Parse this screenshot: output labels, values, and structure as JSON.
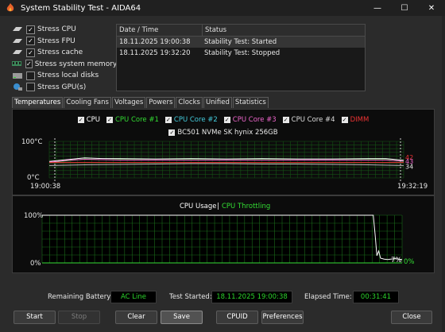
{
  "window": {
    "title": "System Stability Test - AIDA64",
    "min_glyph": "—",
    "max_glyph": "☐",
    "close_glyph": "✕"
  },
  "stress_options": [
    {
      "label": "Stress CPU",
      "checked": true,
      "icon": "cpu-icon"
    },
    {
      "label": "Stress FPU",
      "checked": true,
      "icon": "fpu-icon"
    },
    {
      "label": "Stress cache",
      "checked": true,
      "icon": "cache-icon"
    },
    {
      "label": "Stress system memory",
      "checked": true,
      "icon": "memory-icon"
    },
    {
      "label": "Stress local disks",
      "checked": false,
      "icon": "disk-icon"
    },
    {
      "label": "Stress GPU(s)",
      "checked": false,
      "icon": "gpu-icon"
    }
  ],
  "log": {
    "columns": [
      "Date / Time",
      "Status"
    ],
    "rows": [
      {
        "datetime": "18.11.2025 19:00:38",
        "status": "Stability Test: Started"
      },
      {
        "datetime": "18.11.2025 19:32:20",
        "status": "Stability Test: Stopped"
      }
    ]
  },
  "tabs": [
    {
      "label": "Temperatures",
      "active": true
    },
    {
      "label": "Cooling Fans",
      "active": false
    },
    {
      "label": "Voltages",
      "active": false
    },
    {
      "label": "Powers",
      "active": false
    },
    {
      "label": "Clocks",
      "active": false
    },
    {
      "label": "Unified",
      "active": false
    },
    {
      "label": "Statistics",
      "active": false
    }
  ],
  "temp_legend_row1": [
    {
      "label": "CPU",
      "color": "#ffffff",
      "checked": true
    },
    {
      "label": "CPU Core #1",
      "color": "#33dd33",
      "checked": true
    },
    {
      "label": "CPU Core #2",
      "color": "#44ccdd",
      "checked": true
    },
    {
      "label": "CPU Core #3",
      "color": "#ee66cc",
      "checked": true
    },
    {
      "label": "CPU Core #4",
      "color": "#dddddd",
      "checked": true
    },
    {
      "label": "DIMM",
      "color": "#ee3333",
      "checked": true
    }
  ],
  "temp_legend_row2": [
    {
      "label": "BC501 NVMe SK hynix 256GB",
      "color": "#e8e8e8",
      "checked": true
    }
  ],
  "chart_data": [
    {
      "type": "line",
      "title": "",
      "x_labels": [
        "19:00:38",
        "19:32:19"
      ],
      "ylim": [
        0,
        100
      ],
      "y_labels": [
        "100°C",
        "0°C"
      ],
      "grid": true,
      "series": [
        {
          "name": "CPU",
          "color": "#ffffff",
          "x": [
            0,
            0.05,
            0.1,
            0.15,
            0.2,
            0.3,
            0.4,
            0.5,
            0.6,
            0.7,
            0.8,
            0.9,
            0.95,
            1.0
          ],
          "values": [
            45,
            50,
            55,
            53,
            53,
            52,
            53,
            52,
            53,
            52,
            52,
            53,
            53,
            48
          ]
        },
        {
          "name": "CPU Core #1",
          "color": "#33dd33",
          "x": [
            0,
            0.05,
            0.1,
            0.15,
            0.2,
            0.3,
            0.4,
            0.5,
            0.6,
            0.7,
            0.8,
            0.9,
            0.95,
            1.0
          ],
          "values": [
            42,
            47,
            52,
            50,
            50,
            49,
            50,
            49,
            50,
            49,
            49,
            50,
            50,
            45
          ]
        },
        {
          "name": "CPU Core #3",
          "color": "#ee66cc",
          "x": [
            0,
            0.05,
            0.1,
            0.15,
            0.2,
            0.3,
            0.4,
            0.5,
            0.6,
            0.7,
            0.8,
            0.9,
            0.95,
            1.0
          ],
          "values": [
            43,
            48,
            51,
            50,
            49,
            49,
            49,
            49,
            49,
            49,
            49,
            49,
            49,
            46
          ]
        },
        {
          "name": "DIMM",
          "color": "#ee3333",
          "x": [
            0,
            0.5,
            1.0
          ],
          "values": [
            42,
            42,
            42
          ]
        },
        {
          "name": "BC501 NVMe SK hynix 256GB",
          "color": "#bbbbbb",
          "x": [
            0,
            0.1,
            0.2,
            0.3,
            0.4,
            0.5,
            0.6,
            0.7,
            0.8,
            0.9,
            1.0
          ],
          "values": [
            34,
            36,
            37,
            38,
            39,
            39,
            38,
            38,
            37,
            36,
            34
          ]
        }
      ],
      "end_labels": [
        {
          "text": "42",
          "color": "#ee3333"
        },
        {
          "text": "43",
          "color": "#ee66cc"
        },
        {
          "text": "34",
          "color": "#e8e8e8"
        }
      ]
    },
    {
      "type": "line",
      "title": "CPU Usage",
      "title2": "CPU Throttling",
      "title_sep": "|",
      "ylim": [
        0,
        100
      ],
      "y_labels": [
        "100%",
        "0%"
      ],
      "grid": true,
      "series": [
        {
          "name": "CPU Usage",
          "color": "#ffffff",
          "x": [
            0,
            0.5,
            0.92,
            0.925,
            0.93,
            0.935,
            0.94,
            0.95,
            0.96,
            0.98,
            1.0
          ],
          "values": [
            100,
            100,
            100,
            60,
            15,
            25,
            10,
            8,
            7,
            9,
            7
          ]
        },
        {
          "name": "CPU Throttling",
          "color": "#33dd33",
          "x": [
            0,
            1.0
          ],
          "values": [
            0,
            0
          ]
        }
      ],
      "end_labels": [
        {
          "text": "7%",
          "color": "#ffffff"
        },
        {
          "text": "0%",
          "color": "#33dd33"
        }
      ]
    }
  ],
  "status": {
    "battery_label": "Remaining Battery:",
    "battery_value": "AC Line",
    "started_label": "Test Started:",
    "started_value": "18.11.2025 19:00:38",
    "elapsed_label": "Elapsed Time:",
    "elapsed_value": "00:31:41"
  },
  "buttons": {
    "start": "Start",
    "stop": "Stop",
    "clear": "Clear",
    "save": "Save",
    "cpuid": "CPUID",
    "preferences": "Preferences",
    "close": "Close"
  }
}
